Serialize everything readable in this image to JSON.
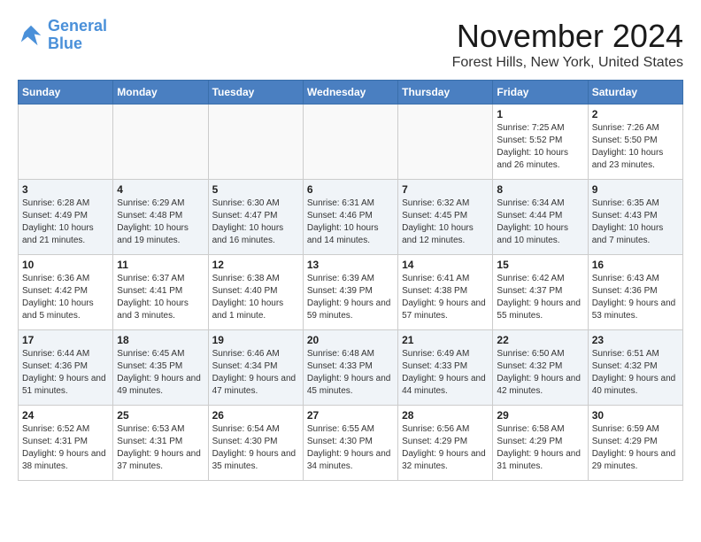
{
  "header": {
    "logo_line1": "General",
    "logo_line2": "Blue",
    "month_title": "November 2024",
    "location": "Forest Hills, New York, United States"
  },
  "days_of_week": [
    "Sunday",
    "Monday",
    "Tuesday",
    "Wednesday",
    "Thursday",
    "Friday",
    "Saturday"
  ],
  "weeks": [
    [
      {
        "num": "",
        "info": ""
      },
      {
        "num": "",
        "info": ""
      },
      {
        "num": "",
        "info": ""
      },
      {
        "num": "",
        "info": ""
      },
      {
        "num": "",
        "info": ""
      },
      {
        "num": "1",
        "info": "Sunrise: 7:25 AM\nSunset: 5:52 PM\nDaylight: 10 hours and 26 minutes."
      },
      {
        "num": "2",
        "info": "Sunrise: 7:26 AM\nSunset: 5:50 PM\nDaylight: 10 hours and 23 minutes."
      }
    ],
    [
      {
        "num": "3",
        "info": "Sunrise: 6:28 AM\nSunset: 4:49 PM\nDaylight: 10 hours and 21 minutes."
      },
      {
        "num": "4",
        "info": "Sunrise: 6:29 AM\nSunset: 4:48 PM\nDaylight: 10 hours and 19 minutes."
      },
      {
        "num": "5",
        "info": "Sunrise: 6:30 AM\nSunset: 4:47 PM\nDaylight: 10 hours and 16 minutes."
      },
      {
        "num": "6",
        "info": "Sunrise: 6:31 AM\nSunset: 4:46 PM\nDaylight: 10 hours and 14 minutes."
      },
      {
        "num": "7",
        "info": "Sunrise: 6:32 AM\nSunset: 4:45 PM\nDaylight: 10 hours and 12 minutes."
      },
      {
        "num": "8",
        "info": "Sunrise: 6:34 AM\nSunset: 4:44 PM\nDaylight: 10 hours and 10 minutes."
      },
      {
        "num": "9",
        "info": "Sunrise: 6:35 AM\nSunset: 4:43 PM\nDaylight: 10 hours and 7 minutes."
      }
    ],
    [
      {
        "num": "10",
        "info": "Sunrise: 6:36 AM\nSunset: 4:42 PM\nDaylight: 10 hours and 5 minutes."
      },
      {
        "num": "11",
        "info": "Sunrise: 6:37 AM\nSunset: 4:41 PM\nDaylight: 10 hours and 3 minutes."
      },
      {
        "num": "12",
        "info": "Sunrise: 6:38 AM\nSunset: 4:40 PM\nDaylight: 10 hours and 1 minute."
      },
      {
        "num": "13",
        "info": "Sunrise: 6:39 AM\nSunset: 4:39 PM\nDaylight: 9 hours and 59 minutes."
      },
      {
        "num": "14",
        "info": "Sunrise: 6:41 AM\nSunset: 4:38 PM\nDaylight: 9 hours and 57 minutes."
      },
      {
        "num": "15",
        "info": "Sunrise: 6:42 AM\nSunset: 4:37 PM\nDaylight: 9 hours and 55 minutes."
      },
      {
        "num": "16",
        "info": "Sunrise: 6:43 AM\nSunset: 4:36 PM\nDaylight: 9 hours and 53 minutes."
      }
    ],
    [
      {
        "num": "17",
        "info": "Sunrise: 6:44 AM\nSunset: 4:36 PM\nDaylight: 9 hours and 51 minutes."
      },
      {
        "num": "18",
        "info": "Sunrise: 6:45 AM\nSunset: 4:35 PM\nDaylight: 9 hours and 49 minutes."
      },
      {
        "num": "19",
        "info": "Sunrise: 6:46 AM\nSunset: 4:34 PM\nDaylight: 9 hours and 47 minutes."
      },
      {
        "num": "20",
        "info": "Sunrise: 6:48 AM\nSunset: 4:33 PM\nDaylight: 9 hours and 45 minutes."
      },
      {
        "num": "21",
        "info": "Sunrise: 6:49 AM\nSunset: 4:33 PM\nDaylight: 9 hours and 44 minutes."
      },
      {
        "num": "22",
        "info": "Sunrise: 6:50 AM\nSunset: 4:32 PM\nDaylight: 9 hours and 42 minutes."
      },
      {
        "num": "23",
        "info": "Sunrise: 6:51 AM\nSunset: 4:32 PM\nDaylight: 9 hours and 40 minutes."
      }
    ],
    [
      {
        "num": "24",
        "info": "Sunrise: 6:52 AM\nSunset: 4:31 PM\nDaylight: 9 hours and 38 minutes."
      },
      {
        "num": "25",
        "info": "Sunrise: 6:53 AM\nSunset: 4:31 PM\nDaylight: 9 hours and 37 minutes."
      },
      {
        "num": "26",
        "info": "Sunrise: 6:54 AM\nSunset: 4:30 PM\nDaylight: 9 hours and 35 minutes."
      },
      {
        "num": "27",
        "info": "Sunrise: 6:55 AM\nSunset: 4:30 PM\nDaylight: 9 hours and 34 minutes."
      },
      {
        "num": "28",
        "info": "Sunrise: 6:56 AM\nSunset: 4:29 PM\nDaylight: 9 hours and 32 minutes."
      },
      {
        "num": "29",
        "info": "Sunrise: 6:58 AM\nSunset: 4:29 PM\nDaylight: 9 hours and 31 minutes."
      },
      {
        "num": "30",
        "info": "Sunrise: 6:59 AM\nSunset: 4:29 PM\nDaylight: 9 hours and 29 minutes."
      }
    ]
  ]
}
